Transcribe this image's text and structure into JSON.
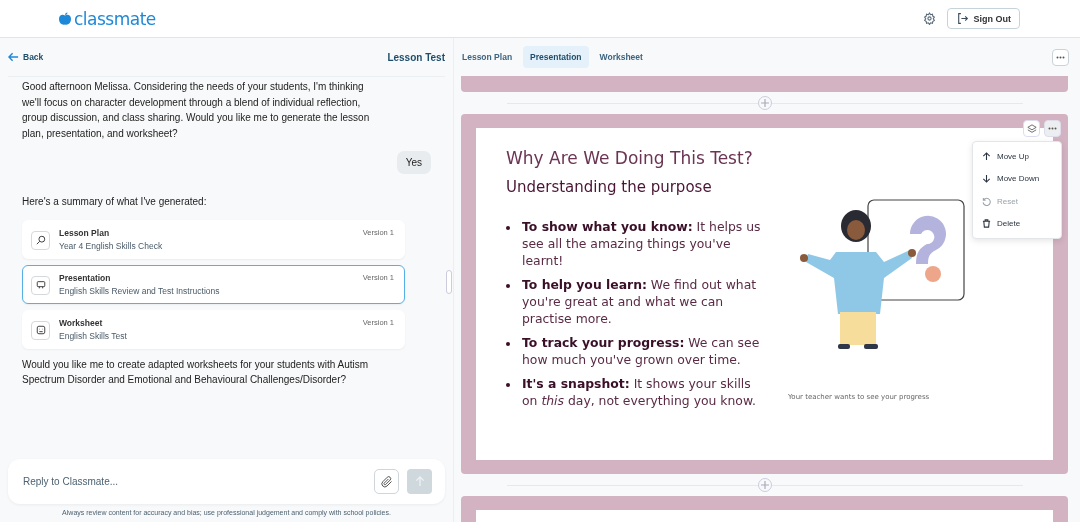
{
  "header": {
    "logo": "classmate",
    "sign_out": "Sign Out"
  },
  "toolbar": {
    "back": "Back",
    "title": "Lesson Test",
    "tabs": [
      {
        "label": "Lesson Plan",
        "selected": false
      },
      {
        "label": "Presentation",
        "selected": true
      },
      {
        "label": "Worksheet",
        "selected": false
      }
    ]
  },
  "chat": {
    "messages": [
      {
        "kind": "assistant",
        "text": "Good afternoon Melissa. Considering the needs of your students, I'm thinking we'll focus on character development through a blend of individual reflection, group discussion, and class sharing. Would you like me to generate the lesson plan, presentation, and worksheet?"
      },
      {
        "kind": "user",
        "text": "Yes"
      },
      {
        "kind": "assistant",
        "text": "Here's a summary of what I've generated:"
      }
    ],
    "artifacts": [
      {
        "kind": "lesson",
        "title": "Lesson Plan",
        "subtitle": "Year 4 English Skills Check",
        "version": "Version 1",
        "selected": false
      },
      {
        "kind": "presentation",
        "title": "Presentation",
        "subtitle": "English Skills Review and Test Instructions",
        "version": "Version 1",
        "selected": true
      },
      {
        "kind": "worksheet",
        "title": "Worksheet",
        "subtitle": "English Skills Test",
        "version": "Version 1",
        "selected": false
      }
    ],
    "followup": "Would you like me to create adapted worksheets for your students with Autism Spectrum Disorder and Emotional and Behavioural Challenges/Disorder?",
    "input": {
      "placeholder": "Reply to Classmate..."
    },
    "disclaimer": "Always review content for accuracy and bias; use professional judgement and comply with school policies."
  },
  "slide": {
    "title": "Why Are We Doing This Test?",
    "subtitle": "Understanding the purpose",
    "bullets": [
      "**To show what you know:** It helps us see all the amazing things you've learnt!",
      "**To help you learn:** We find out what you're great at and what we can practise more.",
      "**To track your progress:** We can see how much you've grown over time.",
      "**It's a snapshot:** It shows your skills on *this* day, not everything you know."
    ],
    "caption": "Your teacher wants to see your progress",
    "menu": [
      {
        "kind": "up",
        "label": "Move Up",
        "disabled": false
      },
      {
        "kind": "down",
        "label": "Move Down",
        "disabled": false
      },
      {
        "kind": "reset",
        "label": "Reset",
        "disabled": true
      },
      {
        "kind": "delete",
        "label": "Delete",
        "disabled": false
      }
    ]
  }
}
